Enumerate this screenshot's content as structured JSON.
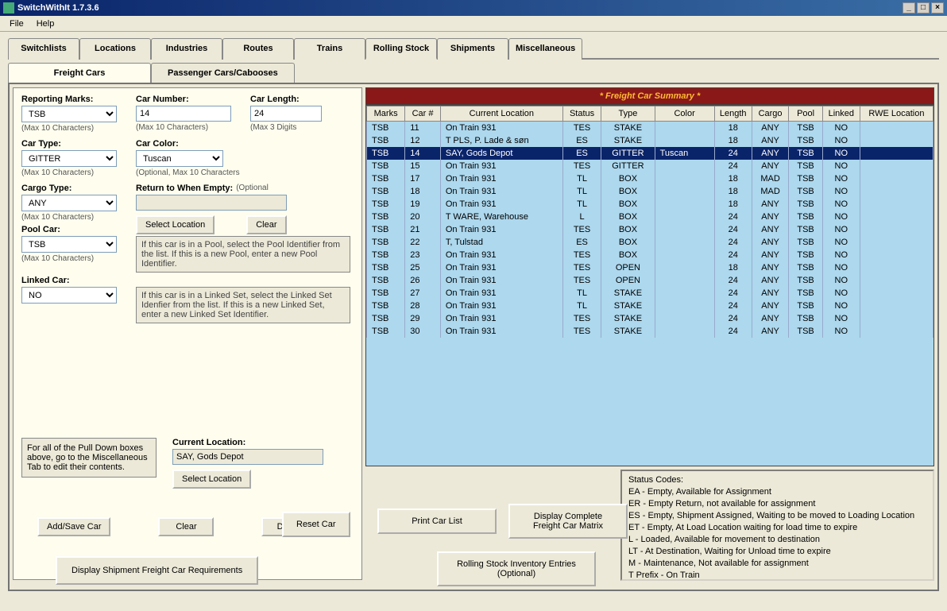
{
  "app": {
    "title": "SwitchWithIt 1.7.3.6"
  },
  "menu": [
    "File",
    "Help"
  ],
  "tabs": [
    "Switchlists",
    "Locations",
    "Industries",
    "Routes",
    "Trains",
    "Rolling Stock",
    "Shipments",
    "Miscellaneous"
  ],
  "active_tab": "Rolling Stock",
  "subtabs": [
    "Freight Cars",
    "Passenger Cars/Cabooses"
  ],
  "active_subtab": "Freight Cars",
  "fields": {
    "reporting_marks": {
      "label": "Reporting Marks:",
      "value": "TSB",
      "hint": "(Max 10 Characters)"
    },
    "car_number": {
      "label": "Car Number:",
      "value": "14",
      "hint": "(Max 10 Characters)"
    },
    "car_length": {
      "label": "Car Length:",
      "value": "24",
      "hint": "(Max 3 Digits"
    },
    "car_type": {
      "label": "Car Type:",
      "value": "GITTER",
      "hint": "(Max 10 Characters)"
    },
    "car_color": {
      "label": "Car Color:",
      "value": "Tuscan",
      "hint": "(Optional, Max 10 Characters"
    },
    "cargo_type": {
      "label": "Cargo Type:",
      "value": "ANY",
      "hint": "(Max 10 Characters)"
    },
    "return_empty": {
      "label": "Return to When Empty:",
      "label2": "(Optional",
      "value": ""
    },
    "pool_car": {
      "label": "Pool Car:",
      "value": "TSB",
      "hint": "(Max 10 Characters)",
      "help": "If this car is in a Pool, select the Pool Identifier from the list.  If this is a new Pool, enter a new Pool Identifier."
    },
    "linked_car": {
      "label": "Linked Car:",
      "value": "NO",
      "help": "If this car is in a Linked Set, select the Linked Set Idenfier from the list.  If this is a new Linked Set, enter a new Linked Set Identifier."
    },
    "current_location": {
      "label": "Current Location:",
      "value": "SAY, Gods Depot"
    },
    "misc_hint": "For all of the Pull Down boxes above, go to the Miscellaneous Tab to edit their contents."
  },
  "buttons": {
    "select_location": "Select Location",
    "clear": "Clear",
    "add_save": "Add/Save Car",
    "delete": "Delete",
    "reset_car": "Reset Car",
    "print_car_list": "Print Car List",
    "display_matrix": "Display Complete\nFreight Car Matrix",
    "display_requirements": "Display Shipment Freight Car Requirements",
    "inventory": "Rolling Stock Inventory Entries\n(Optional)"
  },
  "summary": {
    "title": "* Freight Car Summary *",
    "columns": [
      "Marks",
      "Car #",
      "Current Location",
      "Status",
      "Type",
      "Color",
      "Length",
      "Cargo",
      "Pool",
      "Linked",
      "RWE Location"
    ],
    "selected_index": 2,
    "rows": [
      [
        "TSB",
        "11",
        "On Train 931",
        "TES",
        "STAKE",
        "",
        "18",
        "ANY",
        "TSB",
        "NO",
        ""
      ],
      [
        "TSB",
        "12",
        "T PLS, P. Lade & søn",
        "ES",
        "STAKE",
        "",
        "18",
        "ANY",
        "TSB",
        "NO",
        ""
      ],
      [
        "TSB",
        "14",
        "SAY, Gods Depot",
        "ES",
        "GITTER",
        "Tuscan",
        "24",
        "ANY",
        "TSB",
        "NO",
        ""
      ],
      [
        "TSB",
        "15",
        "On Train 931",
        "TES",
        "GITTER",
        "",
        "24",
        "ANY",
        "TSB",
        "NO",
        ""
      ],
      [
        "TSB",
        "17",
        "On Train 931",
        "TL",
        "BOX",
        "",
        "18",
        "MAD",
        "TSB",
        "NO",
        ""
      ],
      [
        "TSB",
        "18",
        "On Train 931",
        "TL",
        "BOX",
        "",
        "18",
        "MAD",
        "TSB",
        "NO",
        ""
      ],
      [
        "TSB",
        "19",
        "On Train 931",
        "TL",
        "BOX",
        "",
        "18",
        "ANY",
        "TSB",
        "NO",
        ""
      ],
      [
        "TSB",
        "20",
        "T WARE, Warehouse",
        "L",
        "BOX",
        "",
        "24",
        "ANY",
        "TSB",
        "NO",
        ""
      ],
      [
        "TSB",
        "21",
        "On Train 931",
        "TES",
        "BOX",
        "",
        "24",
        "ANY",
        "TSB",
        "NO",
        ""
      ],
      [
        "TSB",
        "22",
        "T, Tulstad",
        "ES",
        "BOX",
        "",
        "24",
        "ANY",
        "TSB",
        "NO",
        ""
      ],
      [
        "TSB",
        "23",
        "On Train 931",
        "TES",
        "BOX",
        "",
        "24",
        "ANY",
        "TSB",
        "NO",
        ""
      ],
      [
        "TSB",
        "25",
        "On Train 931",
        "TES",
        "OPEN",
        "",
        "18",
        "ANY",
        "TSB",
        "NO",
        ""
      ],
      [
        "TSB",
        "26",
        "On Train 931",
        "TES",
        "OPEN",
        "",
        "24",
        "ANY",
        "TSB",
        "NO",
        ""
      ],
      [
        "TSB",
        "27",
        "On Train 931",
        "TL",
        "STAKE",
        "",
        "24",
        "ANY",
        "TSB",
        "NO",
        ""
      ],
      [
        "TSB",
        "28",
        "On Train 931",
        "TL",
        "STAKE",
        "",
        "24",
        "ANY",
        "TSB",
        "NO",
        ""
      ],
      [
        "TSB",
        "29",
        "On Train 931",
        "TES",
        "STAKE",
        "",
        "24",
        "ANY",
        "TSB",
        "NO",
        ""
      ],
      [
        "TSB",
        "30",
        "On Train 931",
        "TES",
        "STAKE",
        "",
        "24",
        "ANY",
        "TSB",
        "NO",
        ""
      ]
    ]
  },
  "status_codes": {
    "title": "Status Codes:",
    "lines": [
      "EA - Empty, Available for Assignment",
      "ER - Empty Return, not available for assignment",
      "ES - Empty, Shipment Assigned, Waiting to be moved to Loading Location",
      "ET - Empty, At Load Location waiting for load time to expire",
      "L - Loaded, Available for movement to destination",
      "LT - At Destination, Waiting for Unload time to expire",
      "M - Maintenance, Not available for assignment",
      "T Prefix - On Train"
    ]
  }
}
